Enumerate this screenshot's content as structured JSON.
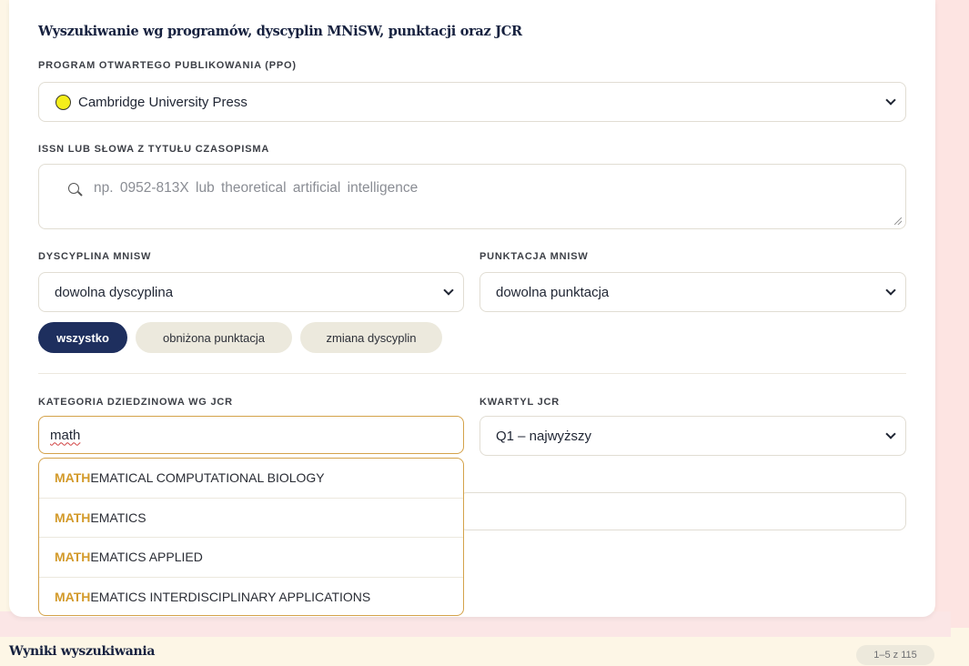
{
  "section_title": "Wyszukiwanie wg programów, dyscyplin MNiSW, punktacji oraz JCR",
  "ppo": {
    "label": "PROGRAM OTWARTEGO PUBLIKOWANIA (PPO)",
    "selected": "Cambridge University Press",
    "dot_color": "#f5ee1b"
  },
  "issn": {
    "label": "ISSN LUB SŁOWA Z TYTUŁU CZASOPISMA",
    "placeholder": "np. 0952-813X  lub  theoretical artificial intelligence"
  },
  "discipline": {
    "label": "DYSCYPLINA MNISW",
    "selected": "dowolna dyscyplina"
  },
  "points": {
    "label": "PUNKTACJA MNISW",
    "selected": "dowolna punktacja"
  },
  "filter_pills": [
    {
      "label": "wszystko",
      "active": true
    },
    {
      "label": "obniżona punktacja",
      "active": false
    },
    {
      "label": "zmiana dyscyplin",
      "active": false
    }
  ],
  "jcr_category": {
    "label": "KATEGORIA DZIEDZINOWA WG JCR",
    "value": "math",
    "suggestions": [
      {
        "match": "MATH",
        "rest": "EMATICAL COMPUTATIONAL BIOLOGY"
      },
      {
        "match": "MATH",
        "rest": "EMATICS"
      },
      {
        "match": "MATH",
        "rest": "EMATICS APPLIED"
      },
      {
        "match": "MATH",
        "rest": "EMATICS INTERDISCIPLINARY APPLICATIONS"
      }
    ]
  },
  "jcr_quartile": {
    "label": "KWARTYL JCR",
    "selected": "Q1 – najwyższy"
  },
  "results": {
    "title": "Wyniki wyszukiwania",
    "count": "1–5 z 115"
  },
  "colors": {
    "accent_navy": "#1e2f5e",
    "highlight_gold": "#d39a2a"
  }
}
